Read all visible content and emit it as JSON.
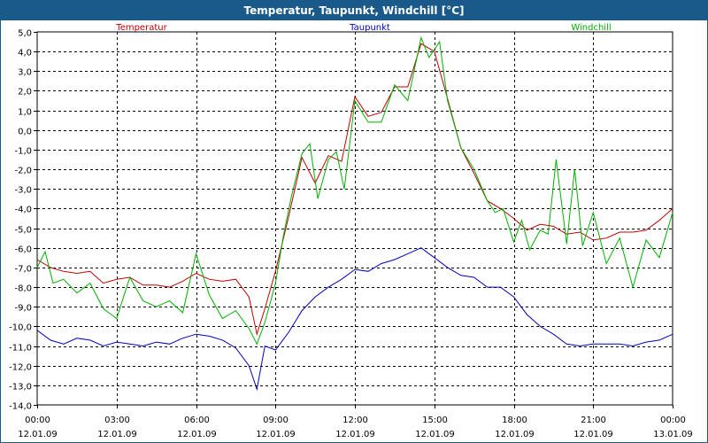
{
  "window": {
    "title": "Temperatur, Taupunkt, Windchill [°C]"
  },
  "chart_data": {
    "type": "line",
    "title": "Temperatur, Taupunkt, Windchill [°C]",
    "xlabel": "",
    "ylabel": "",
    "ylim": [
      -14,
      5
    ],
    "grid": true,
    "legend": "top",
    "y_ticks": [
      "5,0",
      "4,0",
      "3,0",
      "2,0",
      "1,0",
      "0,0",
      "-1,0",
      "-2,0",
      "-3,0",
      "-4,0",
      "-5,0",
      "-6,0",
      "-7,0",
      "-8,0",
      "-9,0",
      "-10,0",
      "-11,0",
      "-12,0",
      "-13,0",
      "-14,0"
    ],
    "x_ticks": [
      {
        "time": "00:00",
        "date": "12.01.09"
      },
      {
        "time": "03:00",
        "date": "12.01.09"
      },
      {
        "time": "06:00",
        "date": "12.01.09"
      },
      {
        "time": "09:00",
        "date": "12.01.09"
      },
      {
        "time": "12:00",
        "date": "12.01.09"
      },
      {
        "time": "15:00",
        "date": "12.01.09"
      },
      {
        "time": "18:00",
        "date": "12.01.09"
      },
      {
        "time": "21:00",
        "date": "12.01.09"
      },
      {
        "time": "00:00",
        "date": "13.01.09"
      }
    ],
    "x_unit": "hours since 12.01.09 00:00",
    "series": [
      {
        "name": "Temperatur",
        "color": "#c00000",
        "x": [
          0,
          0.5,
          1,
          1.5,
          2,
          2.5,
          3,
          3.5,
          4,
          4.5,
          5,
          5.5,
          6,
          6.5,
          7,
          7.5,
          8,
          8.3,
          8.6,
          9,
          9.5,
          10,
          10.5,
          11,
          11.5,
          12,
          12.5,
          13,
          13.5,
          14,
          14.5,
          15,
          15.5,
          16,
          16.5,
          17,
          17.5,
          18,
          18.5,
          19,
          19.5,
          20,
          20.5,
          21,
          21.5,
          22,
          22.5,
          23,
          23.5,
          24
        ],
        "values": [
          -6.6,
          -7.0,
          -7.2,
          -7.3,
          -7.2,
          -7.8,
          -7.6,
          -7.5,
          -7.9,
          -7.9,
          -8.0,
          -7.7,
          -7.3,
          -7.6,
          -7.7,
          -7.6,
          -8.5,
          -10.4,
          -9.1,
          -7.2,
          -4.4,
          -1.4,
          -2.7,
          -1.3,
          -1.6,
          1.7,
          0.7,
          0.9,
          2.2,
          2.2,
          4.4,
          4.0,
          1.6,
          -0.9,
          -2.2,
          -3.6,
          -4.0,
          -4.5,
          -5.1,
          -4.8,
          -4.9,
          -5.3,
          -5.2,
          -5.6,
          -5.5,
          -5.2,
          -5.2,
          -5.1,
          -4.6,
          -4.0
        ]
      },
      {
        "name": "Taupunkt",
        "color": "#0000c0",
        "x": [
          0,
          0.5,
          1,
          1.5,
          2,
          2.5,
          3,
          3.5,
          4,
          4.5,
          5,
          5.5,
          6,
          6.5,
          7,
          7.5,
          8,
          8.3,
          8.6,
          9,
          9.5,
          10,
          10.5,
          11,
          11.5,
          12,
          12.5,
          13,
          13.5,
          14,
          14.5,
          15,
          15.5,
          16,
          16.5,
          17,
          17.5,
          18,
          18.5,
          19,
          19.5,
          20,
          20.5,
          21,
          21.5,
          22,
          22.5,
          23,
          23.5,
          24
        ],
        "values": [
          -10.2,
          -10.7,
          -10.9,
          -10.6,
          -10.7,
          -11.0,
          -10.8,
          -10.9,
          -11.0,
          -10.8,
          -10.9,
          -10.6,
          -10.4,
          -10.5,
          -10.7,
          -11.1,
          -12.0,
          -13.2,
          -11.0,
          -11.2,
          -10.3,
          -9.2,
          -8.5,
          -8.0,
          -7.6,
          -7.1,
          -7.2,
          -6.8,
          -6.6,
          -6.3,
          -6.0,
          -6.5,
          -7.0,
          -7.4,
          -7.5,
          -8.0,
          -8.0,
          -8.5,
          -9.4,
          -10.0,
          -10.4,
          -10.9,
          -11.0,
          -10.9,
          -10.9,
          -10.9,
          -11.0,
          -10.8,
          -10.7,
          -10.4
        ]
      },
      {
        "name": "Windchill",
        "color": "#00b000",
        "x": [
          0,
          0.3,
          0.6,
          1,
          1.5,
          2,
          2.5,
          3,
          3.5,
          4,
          4.5,
          5,
          5.5,
          6,
          6.5,
          7,
          7.5,
          8,
          8.3,
          8.6,
          9,
          9.3,
          9.6,
          10,
          10.3,
          10.6,
          11,
          11.3,
          11.6,
          12,
          12.5,
          13,
          13.5,
          14,
          14.5,
          14.8,
          15.2,
          15.5,
          16,
          16.5,
          17,
          17.3,
          17.6,
          18,
          18.3,
          18.6,
          19,
          19.3,
          19.6,
          20,
          20.3,
          20.6,
          21,
          21.5,
          22,
          22.5,
          23,
          23.5,
          24
        ],
        "values": [
          -7.0,
          -6.2,
          -7.8,
          -7.6,
          -8.3,
          -7.8,
          -9.1,
          -9.6,
          -7.5,
          -8.7,
          -9.0,
          -8.7,
          -9.3,
          -6.3,
          -8.4,
          -9.6,
          -9.2,
          -10.1,
          -10.9,
          -9.8,
          -7.8,
          -5.4,
          -3.4,
          -1.2,
          -0.7,
          -3.5,
          -1.5,
          -1.1,
          -3.0,
          1.5,
          0.4,
          0.4,
          2.3,
          1.5,
          4.7,
          3.7,
          4.5,
          1.5,
          -0.9,
          -2.0,
          -3.6,
          -4.2,
          -4.0,
          -5.7,
          -4.6,
          -6.1,
          -5.1,
          -5.3,
          -1.5,
          -5.8,
          -2.0,
          -5.9,
          -4.2,
          -6.8,
          -5.5,
          -8.0,
          -5.6,
          -6.5,
          -4.2
        ]
      }
    ]
  }
}
